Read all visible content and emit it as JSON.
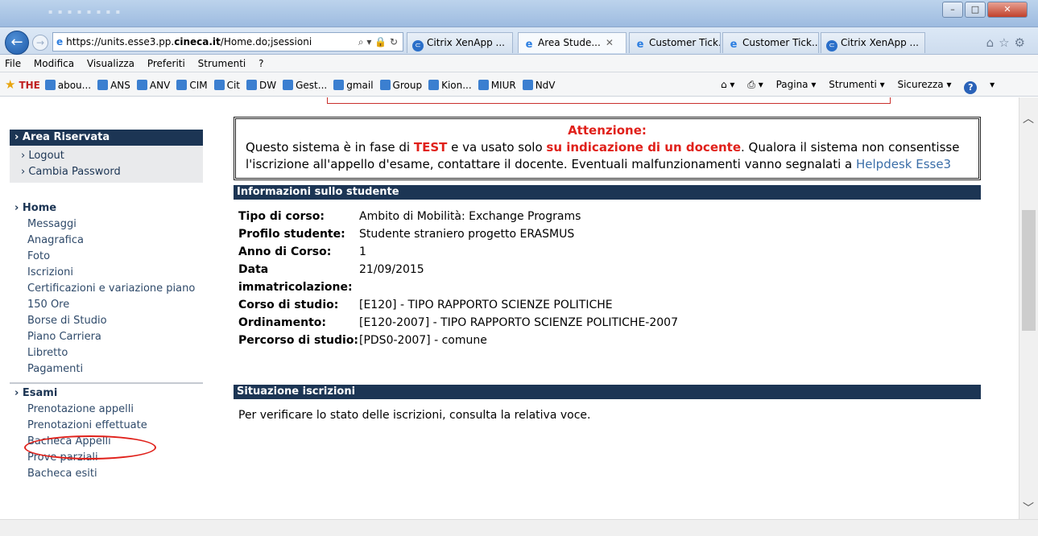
{
  "browser": {
    "address": "https://units.esse3.pp.cineca.it/Home.do;jsessioni",
    "address_prefix": "https://units.esse3.pp.",
    "address_host": "cineca.it",
    "address_rest": "/Home.do;jsessioni",
    "tabs": [
      {
        "label": "Citrix XenApp ...",
        "icon": "citrix-icon",
        "active": false
      },
      {
        "label": "Area Stude...",
        "icon": "ie-icon",
        "active": true
      },
      {
        "label": "Customer Tick...",
        "icon": "ie-icon",
        "active": false
      },
      {
        "label": "Customer Tick...",
        "icon": "ie-icon",
        "active": false
      },
      {
        "label": "Citrix XenApp ...",
        "icon": "citrix-icon",
        "active": false
      }
    ],
    "menu": [
      "File",
      "Modifica",
      "Visualizza",
      "Preferiti",
      "Strumenti",
      "?"
    ],
    "favorites": [
      "abou...",
      "ANS",
      "ANV",
      "CIM",
      "Cit",
      "DW",
      "Gest...",
      "gmail",
      "Group",
      "Kion...",
      "MIUR",
      "NdV"
    ],
    "favorites_brand": "THE",
    "commands": [
      "Pagina ▾",
      "Strumenti ▾",
      "Sicurezza ▾"
    ]
  },
  "sidebar": {
    "reserved_title": "Area Riservata",
    "reserved_items": [
      "Logout",
      "Cambia Password"
    ],
    "home_title": "Home",
    "home_items": [
      "Messaggi",
      "Anagrafica",
      "Foto",
      "Iscrizioni",
      "Certificazioni e variazione piano",
      "150 Ore",
      "Borse di Studio",
      "Piano Carriera",
      "Libretto",
      "Pagamenti"
    ],
    "exams_title": "Esami",
    "exams_items": [
      "Prenotazione appelli",
      "Prenotazioni effettuate",
      "Bacheca Appelli",
      "Prove parziali",
      "Bacheca esiti"
    ]
  },
  "notice": {
    "title": "Attenzione:",
    "t1": "Questo sistema è in fase di ",
    "test": "TEST",
    "t2": " e va usato solo ",
    "hint": "su indicazione di un docente",
    "t3": ". Qualora il sistema non consentisse l'iscrizione all'appello d'esame, contattare il docente. Eventuali malfunzionamenti vanno segnalati a ",
    "link": "Helpdesk Esse3"
  },
  "student": {
    "heading": "Informazioni sullo studente",
    "rows": [
      {
        "label": "Tipo di corso:",
        "value": "Ambito di Mobilità: Exchange Programs"
      },
      {
        "label": "Profilo studente:",
        "value": "Studente straniero progetto ERASMUS"
      },
      {
        "label": "Anno di Corso:",
        "value": "1"
      },
      {
        "label": "Data immatricolazione:",
        "value": "21/09/2015"
      },
      {
        "label": "Corso di studio:",
        "value": "[E120] - TIPO RAPPORTO SCIENZE POLITICHE"
      },
      {
        "label": "Ordinamento:",
        "value": "[E120-2007] - TIPO RAPPORTO SCIENZE POLITICHE-2007"
      },
      {
        "label": "Percorso di studio:",
        "value": "[PDS0-2007] - comune"
      }
    ]
  },
  "enrollment": {
    "heading": "Situazione iscrizioni",
    "text": "Per verificare lo stato delle iscrizioni, consulta la relativa voce."
  },
  "colors": {
    "header_navy": "#1c3554",
    "warning_red": "#e0201a",
    "link_blue": "#3b6ea8"
  }
}
